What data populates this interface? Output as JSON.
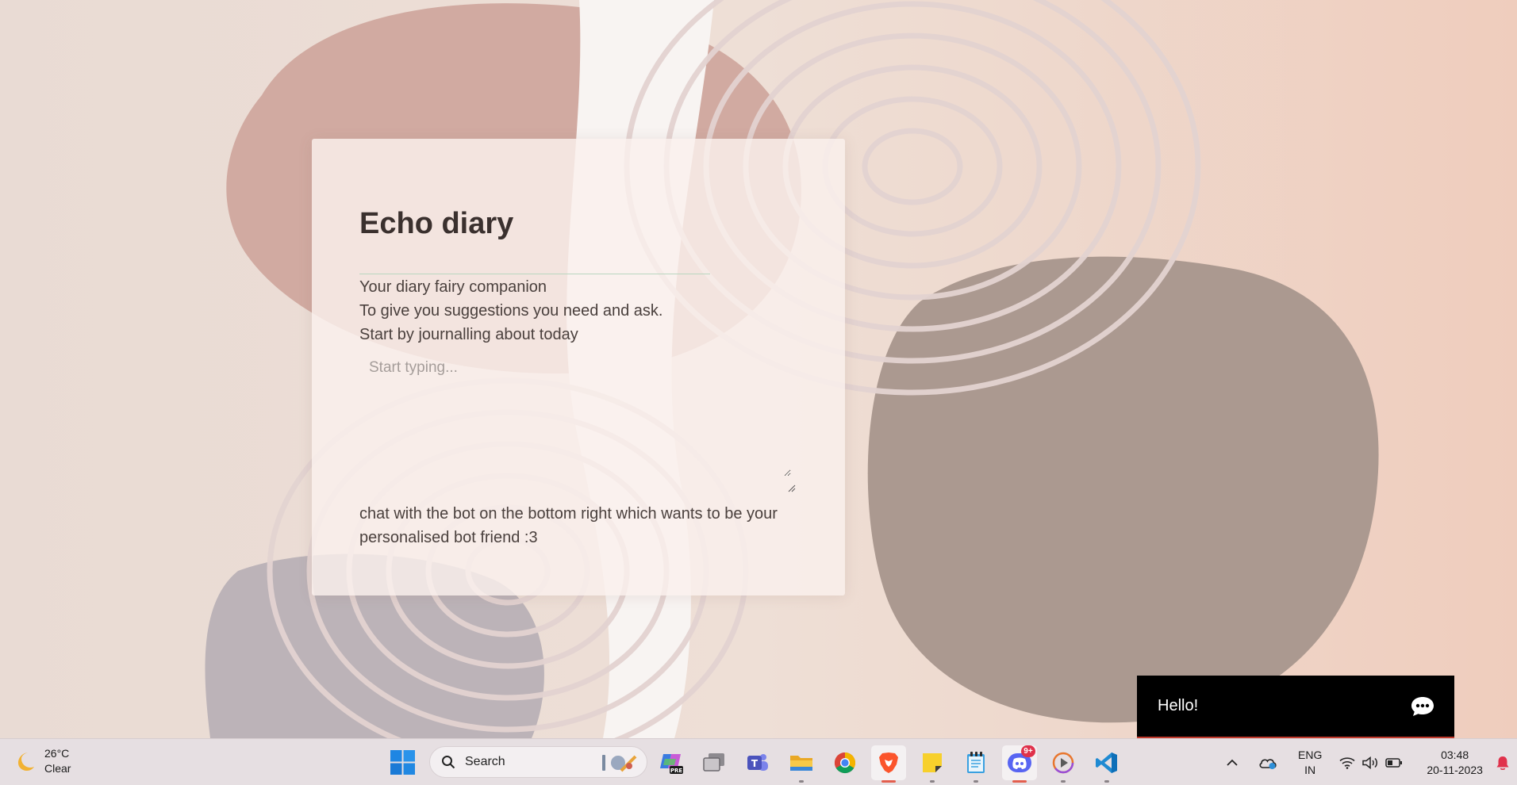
{
  "card": {
    "title": "Echo diary",
    "lines": [
      "Your diary fairy companion",
      "To give you suggestions you need and ask.",
      "Start by journalling about today"
    ],
    "input_placeholder": "Start typing...",
    "input_value": "",
    "footer": "chat with the bot on the bottom right which wants to be your personalised bot friend :3"
  },
  "chat_widget": {
    "label": "Hello!",
    "icon": "chat-bubble-icon"
  },
  "taskbar": {
    "weather": {
      "temperature": "26°C",
      "condition": "Clear",
      "icon": "moon-icon"
    },
    "search_label": "Search",
    "apps": [
      {
        "name": "start",
        "icon": "windows-logo-icon"
      },
      {
        "name": "copilot",
        "icon": "copilot-icon",
        "tag": "PRE"
      },
      {
        "name": "task-view",
        "icon": "task-view-icon"
      },
      {
        "name": "teams",
        "icon": "teams-icon"
      },
      {
        "name": "file-explorer",
        "icon": "folder-icon"
      },
      {
        "name": "chrome",
        "icon": "chrome-icon"
      },
      {
        "name": "brave",
        "icon": "brave-icon"
      },
      {
        "name": "sticky-notes",
        "icon": "sticky-notes-icon"
      },
      {
        "name": "notepad",
        "icon": "notepad-icon"
      },
      {
        "name": "discord",
        "icon": "discord-icon",
        "badge": "9+"
      },
      {
        "name": "media-player",
        "icon": "play-icon"
      },
      {
        "name": "vscode",
        "icon": "vscode-icon"
      }
    ],
    "tray": {
      "language_line1": "ENG",
      "language_line2": "IN",
      "time": "03:48",
      "date": "20-11-2023"
    }
  },
  "colors": {
    "chat_background": "#000000",
    "chat_accent": "#c0392b",
    "card_divider": "#b9d6c0"
  }
}
